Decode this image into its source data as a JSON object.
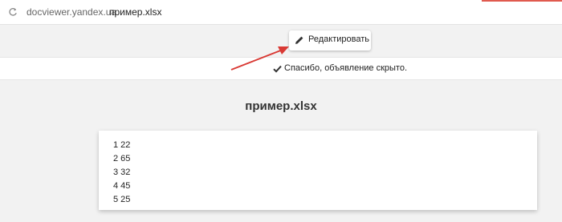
{
  "address_bar": {
    "domain": "docviewer.yandex.ua",
    "file": "пример.xlsx"
  },
  "toolbar": {
    "edit_label": "Редактировать"
  },
  "notice": {
    "text": "Спасибо, объявление скрыто."
  },
  "document": {
    "title": "пример.xlsx",
    "rows": [
      "1 22",
      "2 65",
      "3 32",
      "4 45",
      "5 25"
    ]
  },
  "icons": {
    "reload": "reload-icon",
    "pencil": "pencil-icon",
    "check": "checkmark-icon"
  },
  "colors": {
    "annotation_arrow": "#d93a35",
    "page_background": "#f2f2f2"
  }
}
